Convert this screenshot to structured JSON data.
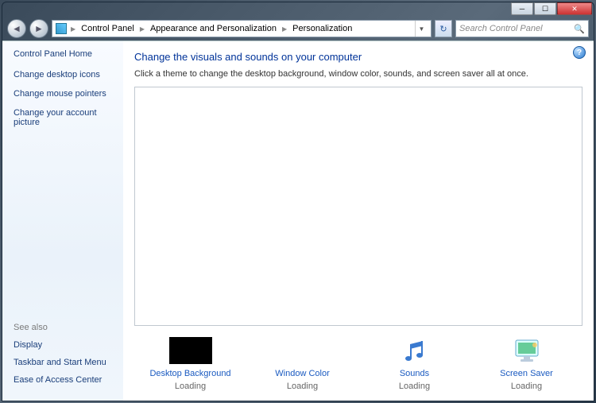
{
  "window": {
    "minimize": "─",
    "maximize": "☐",
    "close": "✕"
  },
  "nav": {
    "back": "◄",
    "forward": "►"
  },
  "breadcrumb": {
    "items": [
      "Control Panel",
      "Appearance and Personalization",
      "Personalization"
    ],
    "sep": "▶",
    "dropdown": "▼",
    "refresh": "↻"
  },
  "search": {
    "placeholder": "Search Control Panel",
    "icon": "🔍"
  },
  "sidebar": {
    "home": "Control Panel Home",
    "tasks": [
      "Change desktop icons",
      "Change mouse pointers",
      "Change your account picture"
    ],
    "seealso_header": "See also",
    "seealso": [
      "Display",
      "Taskbar and Start Menu",
      "Ease of Access Center"
    ]
  },
  "main": {
    "heading": "Change the visuals and sounds on your computer",
    "subtext": "Click a theme to change the desktop background, window color, sounds, and screen saver all at once.",
    "help": "?"
  },
  "settings": [
    {
      "label": "Desktop Background",
      "status": "Loading"
    },
    {
      "label": "Window Color",
      "status": "Loading"
    },
    {
      "label": "Sounds",
      "status": "Loading"
    },
    {
      "label": "Screen Saver",
      "status": "Loading"
    }
  ]
}
